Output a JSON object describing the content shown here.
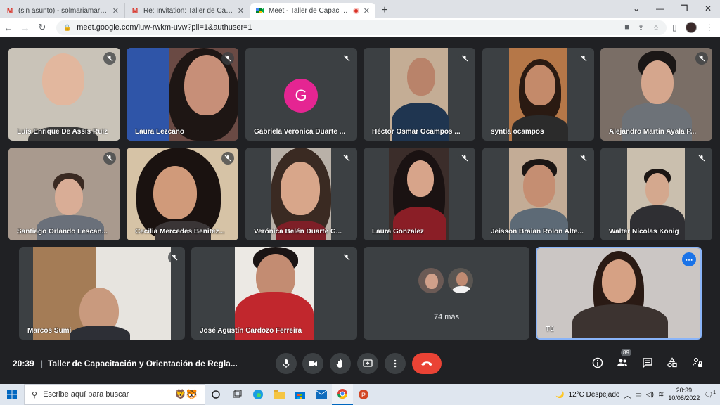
{
  "browser": {
    "tabs": [
      {
        "icon": "gmail-icon",
        "title": "(sin asunto) - solmariamartinezve",
        "active": false
      },
      {
        "icon": "gmail-icon",
        "title": "Re: Invitation: Taller de Capacitació",
        "active": false
      },
      {
        "icon": "meet-icon",
        "title": "Meet - Taller de Capacitació",
        "active": true
      }
    ],
    "url": "meet.google.com/iuw-rwkm-uvw?pli=1&authuser=1"
  },
  "meet": {
    "participants": [
      {
        "name": "Luis Enrique De Assis Ruiz",
        "muted": true
      },
      {
        "name": "Laura Lezcano",
        "muted": true
      },
      {
        "name": "Gabriela Veronica Duarte ...",
        "muted": true,
        "avatar_letter": "G"
      },
      {
        "name": "Héctor Osmar Ocampos ...",
        "muted": true
      },
      {
        "name": "syntia ocampos",
        "muted": true
      },
      {
        "name": "Alejandro Martin Ayala P...",
        "muted": true
      },
      {
        "name": "Santiago Orlando Lescan...",
        "muted": true
      },
      {
        "name": "Cecilia Mercedes Benitez...",
        "muted": true
      },
      {
        "name": "Verónica Belén Duarte G...",
        "muted": true
      },
      {
        "name": "Laura Gonzalez",
        "muted": true
      },
      {
        "name": "Jeisson Braian Rolon Alte...",
        "muted": true
      },
      {
        "name": "Walter Nicolas Konig",
        "muted": true
      },
      {
        "name": "Marcos Sumi",
        "muted": true
      },
      {
        "name": "José Agustín Cardozo Ferreira",
        "muted": true
      }
    ],
    "more_label": "74 más",
    "self_label": "Tú",
    "time": "20:39",
    "separator": "|",
    "meeting_title": "Taller de Capacitación y Orientación de Regla...",
    "people_count": "89"
  },
  "taskbar": {
    "search_placeholder": "Escribe aquí para buscar",
    "weather": "12°C  Despejado",
    "clock_time": "20:39",
    "clock_date": "10/08/2022",
    "notifications": "1"
  },
  "colors": {
    "end_call": "#ea4335",
    "avatar_g": "#e52592",
    "self_border": "#8ab4f8",
    "more_button": "#1a73e8"
  }
}
